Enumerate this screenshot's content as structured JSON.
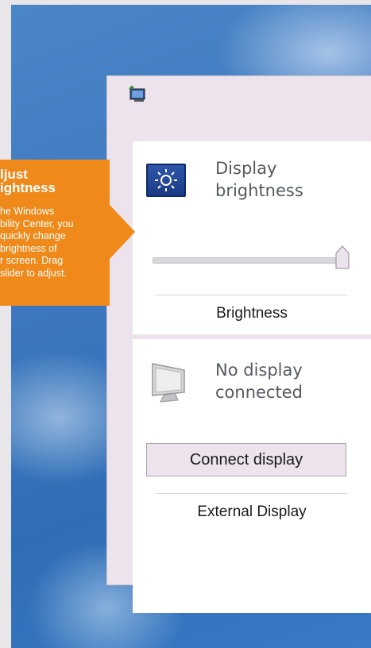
{
  "callout": {
    "heading_line1": "ljust",
    "heading_line2": "ightness",
    "body_lines": [
      "he Windows",
      "bility Center, you",
      "quickly change",
      "brightness of",
      "r screen. Drag",
      "slider to adjust."
    ]
  },
  "mobility_center": {
    "title_icon": "mobility-center-icon",
    "brightness": {
      "icon": "sun-icon",
      "title_line1": "Display",
      "title_line2": "brightness",
      "slider_value": 1.0,
      "footer": "Brightness"
    },
    "external_display": {
      "icon": "monitor-icon",
      "status_line1": "No display",
      "status_line2": "connected",
      "button_label": "Connect display",
      "footer": "External Display"
    }
  },
  "colors": {
    "callout": "#ef8a1a",
    "window_bg": "#ece3ed",
    "desktop": "#3d78be"
  }
}
